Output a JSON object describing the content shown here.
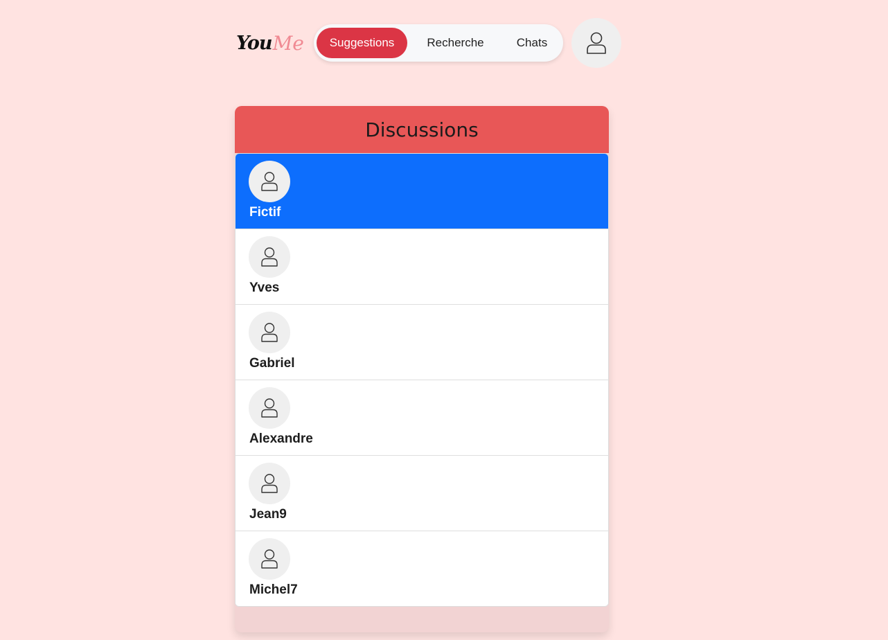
{
  "logo": {
    "part1": "You",
    "part2": "Me"
  },
  "nav": {
    "suggestions": "Suggestions",
    "recherche": "Recherche",
    "chats": "Chats"
  },
  "discussions": {
    "title": "Discussions",
    "contacts": [
      {
        "name": "Fictif",
        "selected": true
      },
      {
        "name": "Yves"
      },
      {
        "name": "Gabriel"
      },
      {
        "name": "Alexandre"
      },
      {
        "name": "Jean9"
      },
      {
        "name": "Michel7"
      }
    ]
  },
  "colors": {
    "background": "#ffe3e1",
    "accent": "#db3545",
    "header": "#e85757",
    "selected": "#0d6efd"
  },
  "icons": {
    "profile": "person-icon",
    "avatar": "person-icon"
  }
}
